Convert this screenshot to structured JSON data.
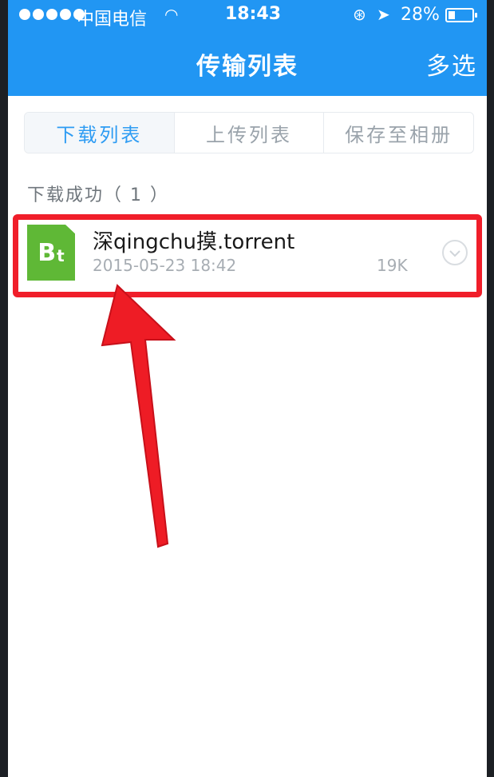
{
  "status_bar": {
    "carrier": "中国电信",
    "time": "18:43",
    "battery": "28%",
    "battery_level": 0.28,
    "icons": [
      "signal-dots-icon",
      "wifi-icon",
      "orientation-lock-icon",
      "location-icon",
      "battery-icon"
    ]
  },
  "header": {
    "title": "传输列表",
    "action": "多选"
  },
  "tabs": [
    {
      "label": "下载列表",
      "active": true
    },
    {
      "label": "上传列表",
      "active": false
    },
    {
      "label": "保存至相册",
      "active": false
    }
  ],
  "section": {
    "label": "下载成功（ 1 ）"
  },
  "file": {
    "icon_text_main": "B",
    "icon_text_sub": "t",
    "name": "深qingchu摸.torrent",
    "date": "2015-05-23 18:42",
    "size": "19K"
  },
  "colors": {
    "accent": "#2196f3",
    "tab_active": "#2e9cf3",
    "highlight": "#f01e2a",
    "bt_icon": "#5fb836"
  }
}
